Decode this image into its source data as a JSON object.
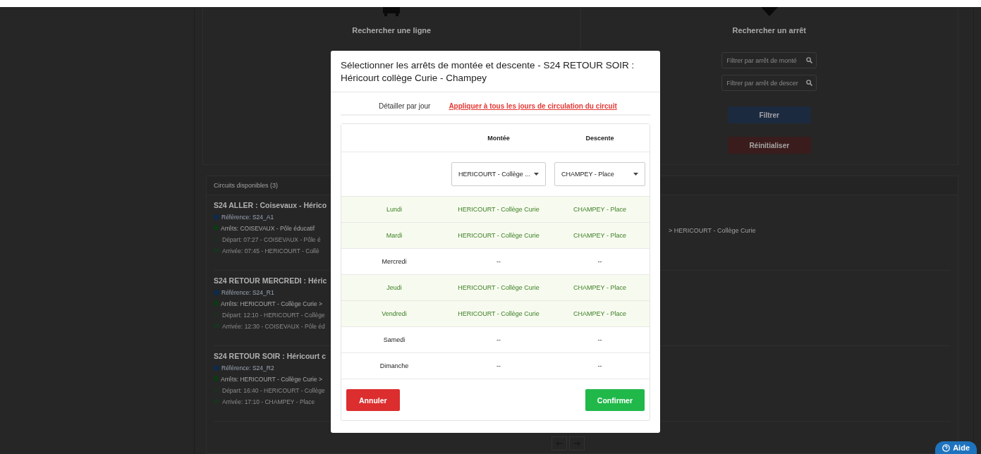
{
  "search_panels": [
    {
      "kind": "line",
      "title": "Rechercher une ligne"
    },
    {
      "kind": "stop",
      "title": "Rechercher un arrêt",
      "fields": [
        {
          "placeholder": "Filtrer par arrêt de monté"
        },
        {
          "placeholder": "Filtrer par arrêt de descer"
        }
      ],
      "buttons": [
        {
          "label": "Filtrer",
          "kind": "primary"
        },
        {
          "label": "Réinitialiser",
          "kind": "danger"
        }
      ]
    }
  ],
  "circuits": {
    "header": "Circuits disponibles (3)",
    "items": [
      {
        "title": "S24 ALLER : Coisevaux - Hérico",
        "reference": "Référence: S24_A1",
        "stops": "Arrêts: COISEVAUX - Pôle éducatif",
        "stops_tail": "> HERICOURT - Collège Curie",
        "departure": "Départ: 07:27 - COISEVAUX - Pôle é",
        "arrival": "Arrivée: 07:45 - HERICOURT - Collè"
      },
      {
        "title": "S24 RETOUR MERCREDI : Héric",
        "reference": "Référence: S24_R1",
        "stops": "Arrêts: HERICOURT - Collège Curie >",
        "departure": "Départ: 12:10 - HERICOURT - Collège",
        "arrival": "Arrivée: 12:30 - COISEVAUX - Pôle éd"
      },
      {
        "title": "S24 RETOUR SOIR : Héricourt c",
        "reference": "Référence: S24_R2",
        "stops": "Arrêts: HERICOURT - Collège Curie >",
        "departure": "Départ: 16:40 - HERICOURT - Collège",
        "arrival": "Arrivée: 17:10 - CHAMPEY - Place"
      }
    ]
  },
  "help_button": {
    "label": "Aide"
  },
  "modal": {
    "title": "Sélectionner les arrêts de montée et descente - S24 RETOUR SOIR : Héricourt collège Curie - Champey",
    "modes": [
      {
        "label": "Détailler par jour",
        "selected": true
      },
      {
        "label": "Appliquer à tous les jours de circulation du circuit",
        "selected": false
      }
    ],
    "columns": [
      "Montée",
      "Descente"
    ],
    "selects": [
      {
        "value": "HERICOURT - Collège ..."
      },
      {
        "value": "CHAMPEY - Place"
      }
    ],
    "days": [
      {
        "day": "Lundi",
        "boarding": "HERICOURT - Collège Curie",
        "alighting": "CHAMPEY - Place",
        "active": true
      },
      {
        "day": "Mardi",
        "boarding": "HERICOURT - Collège Curie",
        "alighting": "CHAMPEY - Place",
        "active": true
      },
      {
        "day": "Mercredi",
        "boarding": "--",
        "alighting": "--",
        "active": false
      },
      {
        "day": "Jeudi",
        "boarding": "HERICOURT - Collège Curie",
        "alighting": "CHAMPEY - Place",
        "active": true
      },
      {
        "day": "Vendredi",
        "boarding": "HERICOURT - Collège Curie",
        "alighting": "CHAMPEY - Place",
        "active": true
      },
      {
        "day": "Samedi",
        "boarding": "--",
        "alighting": "--",
        "active": false
      },
      {
        "day": "Dimanche",
        "boarding": "--",
        "alighting": "--",
        "active": false
      }
    ],
    "buttons": [
      {
        "label": "Annuler",
        "kind": "danger"
      },
      {
        "label": "Confirmer",
        "kind": "success"
      }
    ]
  }
}
